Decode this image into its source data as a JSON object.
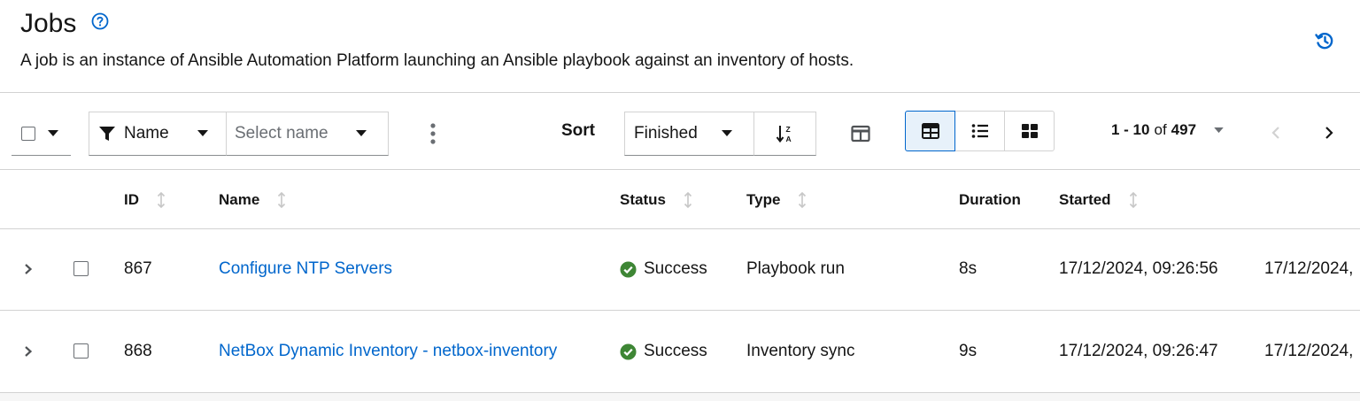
{
  "header": {
    "title": "Jobs",
    "description": "A job is an instance of Ansible Automation Platform launching an Ansible playbook against an inventory of hosts."
  },
  "toolbar": {
    "filter_type": "Name",
    "filter_placeholder": "Select name",
    "sort_label": "Sort",
    "sort_value": "Finished",
    "pagination": {
      "range": "1 - 10",
      "of": "of",
      "total": "497"
    }
  },
  "table": {
    "columns": [
      "ID",
      "Name",
      "Status",
      "Type",
      "Duration",
      "Started"
    ],
    "rows": [
      {
        "id": "867",
        "name": "Configure NTP Servers",
        "status": "Success",
        "type": "Playbook run",
        "duration": "8s",
        "started": "17/12/2024, 09:26:56",
        "finished": "17/12/2024,"
      },
      {
        "id": "868",
        "name": "NetBox Dynamic Inventory - netbox-inventory",
        "status": "Success",
        "type": "Inventory sync",
        "duration": "9s",
        "started": "17/12/2024, 09:26:47",
        "finished": "17/12/2024,"
      }
    ]
  },
  "colors": {
    "link": "#0066cc",
    "success": "#3e8635",
    "border": "#d2d2d2",
    "active_view_bg": "#e7f1fa"
  }
}
